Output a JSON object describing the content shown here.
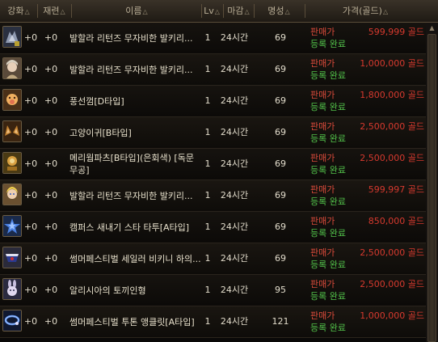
{
  "header": {
    "enhance": "강화",
    "refine": "재련",
    "name": "이름",
    "lv": "Lv",
    "deadline": "마감",
    "reputation": "명성",
    "price": "가격(골드)",
    "sort_arrow": "△"
  },
  "rows": [
    {
      "icon": "dark-armor-icon",
      "enhance": "+0",
      "refine": "+0",
      "name": "발할라 리턴즈 무자비한 발키리...",
      "lv": "1",
      "deadline": "24시간",
      "rep": "69",
      "status1": "판매가",
      "status2": "등록 완료",
      "price": "599,999 골드"
    },
    {
      "icon": "character-portrait-icon",
      "enhance": "+0",
      "refine": "+0",
      "name": "발할라 리턴즈 무자비한 발키리...",
      "lv": "1",
      "deadline": "24시간",
      "rep": "69",
      "status1": "판매가",
      "status2": "등록 완료",
      "price": "1,000,000 골드"
    },
    {
      "icon": "balloon-gum-icon",
      "enhance": "+0",
      "refine": "+0",
      "name": "풍선껌[D타입]",
      "lv": "1",
      "deadline": "24시간",
      "rep": "69",
      "status1": "판매가",
      "status2": "등록 완료",
      "price": "1,800,000 골드"
    },
    {
      "icon": "cat-ears-icon",
      "enhance": "+0",
      "refine": "+0",
      "name": "고양이귀[B타입]",
      "lv": "1",
      "deadline": "24시간",
      "rep": "69",
      "status1": "판매가",
      "status2": "등록 완료",
      "price": "2,500,000 골드"
    },
    {
      "icon": "mary-janes-icon",
      "enhance": "+0",
      "refine": "+0",
      "name": "메리웜파츠[B타입](은회색) [독문무공]",
      "two": true,
      "lv": "1",
      "deadline": "24시간",
      "rep": "69",
      "status1": "판매가",
      "status2": "등록 완료",
      "price": "2,500,000 골드"
    },
    {
      "icon": "blonde-character-icon",
      "enhance": "+0",
      "refine": "+0",
      "name": "발할라 리턴즈 무자비한 발키리...",
      "lv": "1",
      "deadline": "24시간",
      "rep": "69",
      "status1": "판매가",
      "status2": "등록 완료",
      "price": "599,997 골드"
    },
    {
      "icon": "blue-star-icon",
      "enhance": "+0",
      "refine": "+0",
      "name": "캠퍼스 새내기 스타 타투[A타입]",
      "lv": "1",
      "deadline": "24시간",
      "rep": "69",
      "status1": "판매가",
      "status2": "등록 완료",
      "price": "850,000 골드"
    },
    {
      "icon": "sailor-bikini-icon",
      "enhance": "+0",
      "refine": "+0",
      "name": "썸머페스티벌 세일러 비키니 하의...",
      "lv": "1",
      "deadline": "24시간",
      "rep": "69",
      "status1": "판매가",
      "status2": "등록 완료",
      "price": "2,500,000 골드"
    },
    {
      "icon": "bunny-doll-icon",
      "enhance": "+0",
      "refine": "+0",
      "name": "알리시아의 토끼인형",
      "lv": "1",
      "deadline": "24시간",
      "rep": "95",
      "status1": "판매가",
      "status2": "등록 완료",
      "price": "2,500,000 골드"
    },
    {
      "icon": "blue-bracelet-icon",
      "enhance": "+0",
      "refine": "+0",
      "name": "썸머페스티벌 투톤 앵클릿[A타입]",
      "lv": "1",
      "deadline": "24시간",
      "rep": "121",
      "status1": "판매가",
      "status2": "등록 완료",
      "price": "1,000,000 골드"
    }
  ]
}
